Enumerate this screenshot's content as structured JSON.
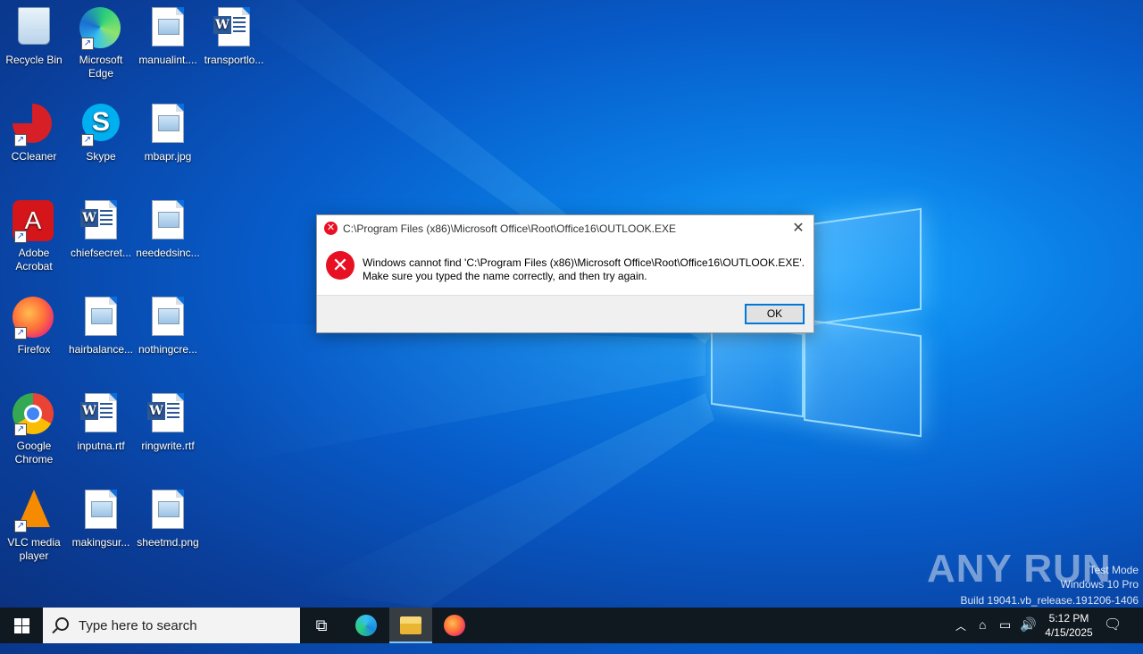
{
  "desktop": {
    "icons": [
      {
        "label": "Recycle Bin",
        "type": "recycle-bin"
      },
      {
        "label": "Microsoft Edge",
        "type": "edge"
      },
      {
        "label": "manualint....",
        "type": "image-file"
      },
      {
        "label": "transportlo...",
        "type": "word-file"
      },
      {
        "label": "CCleaner",
        "type": "ccleaner"
      },
      {
        "label": "Skype",
        "type": "skype"
      },
      {
        "label": "mbapr.jpg",
        "type": "image-file"
      },
      {
        "label": "Adobe Acrobat",
        "type": "acrobat"
      },
      {
        "label": "chiefsecret...",
        "type": "word-file"
      },
      {
        "label": "neededsinc...",
        "type": "image-file"
      },
      {
        "label": "Firefox",
        "type": "firefox"
      },
      {
        "label": "hairbalance...",
        "type": "image-file"
      },
      {
        "label": "nothingcre...",
        "type": "image-file"
      },
      {
        "label": "Google Chrome",
        "type": "chrome"
      },
      {
        "label": "inputna.rtf",
        "type": "word-file"
      },
      {
        "label": "ringwrite.rtf",
        "type": "word-file"
      },
      {
        "label": "VLC media player",
        "type": "vlc"
      },
      {
        "label": "makingsur...",
        "type": "image-file"
      },
      {
        "label": "sheetmd.png",
        "type": "image-file"
      }
    ]
  },
  "dialog": {
    "title": "C:\\Program Files (x86)\\Microsoft Office\\Root\\Office16\\OUTLOOK.EXE",
    "message_line1": "Windows cannot find 'C:\\Program Files (x86)\\Microsoft Office\\Root\\Office16\\OUTLOOK.EXE'.",
    "message_line2": "Make sure you typed the name correctly, and then try again.",
    "ok_label": "OK",
    "close_glyph": "✕"
  },
  "watermark": {
    "brand": "ANY RUN",
    "mode": "Test Mode",
    "edition": "Windows 10 Pro",
    "build": "Build 19041.vb_release.191206-1406"
  },
  "taskbar": {
    "search_placeholder": "Type here to search",
    "time": "5:12 PM",
    "date": "4/15/2025",
    "apps": [
      "edge-icon",
      "file-explorer-icon",
      "firefox-icon"
    ]
  },
  "colors": {
    "accent": "#0078d7",
    "error": "#e81123",
    "taskbar": "#101820"
  }
}
